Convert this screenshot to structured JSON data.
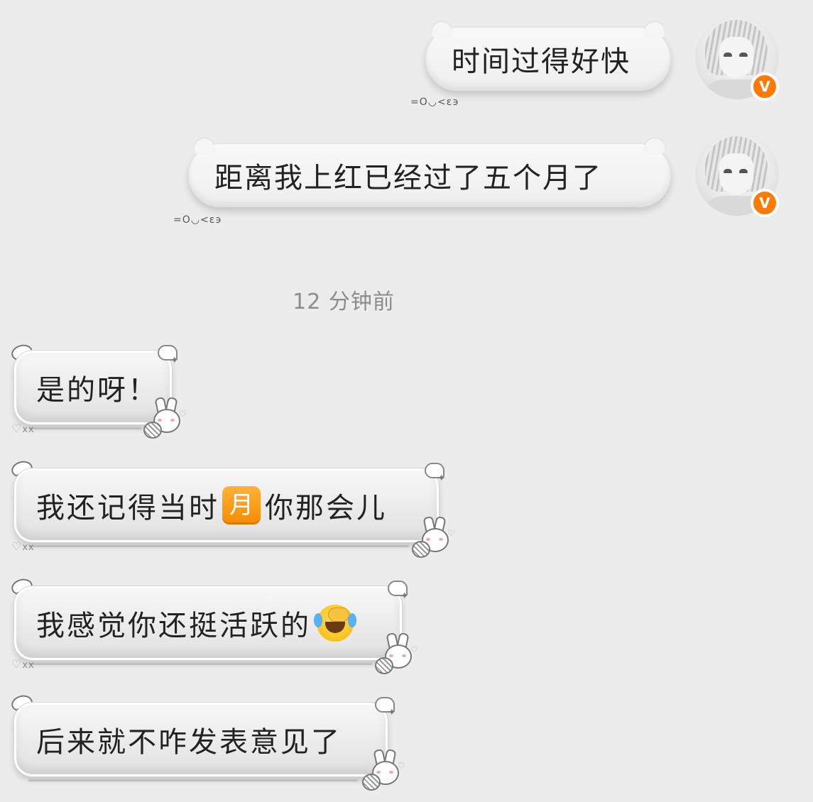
{
  "sent_messages": [
    {
      "text": "时间过得好快",
      "kaomoji": "=O◡<ε϶"
    },
    {
      "text": "距离我上红已经过了五个月了",
      "kaomoji": "=O◡<ε϶"
    }
  ],
  "avatar_badge": "V",
  "timestamp": "12 分钟前",
  "received_messages": [
    {
      "text": "是的呀！"
    },
    {
      "text_before": "我还记得当时",
      "emoji_moon": "月",
      "text_after": "你那会儿"
    },
    {
      "text": "我感觉你还挺活跃的",
      "emoji": "laughing-crying-emoji"
    },
    {
      "text": "后来就不咋发表意见了"
    }
  ],
  "heart_label": "xx",
  "icons": [
    "halo-icon",
    "wing-icon",
    "bunny-sticker-icon",
    "heart-icon",
    "verified-badge-icon"
  ],
  "colors": {
    "background": "#ececec",
    "badge": "#ff7a00",
    "moon_emoji": "#f98a00",
    "timestamp": "#8c8c8c"
  }
}
